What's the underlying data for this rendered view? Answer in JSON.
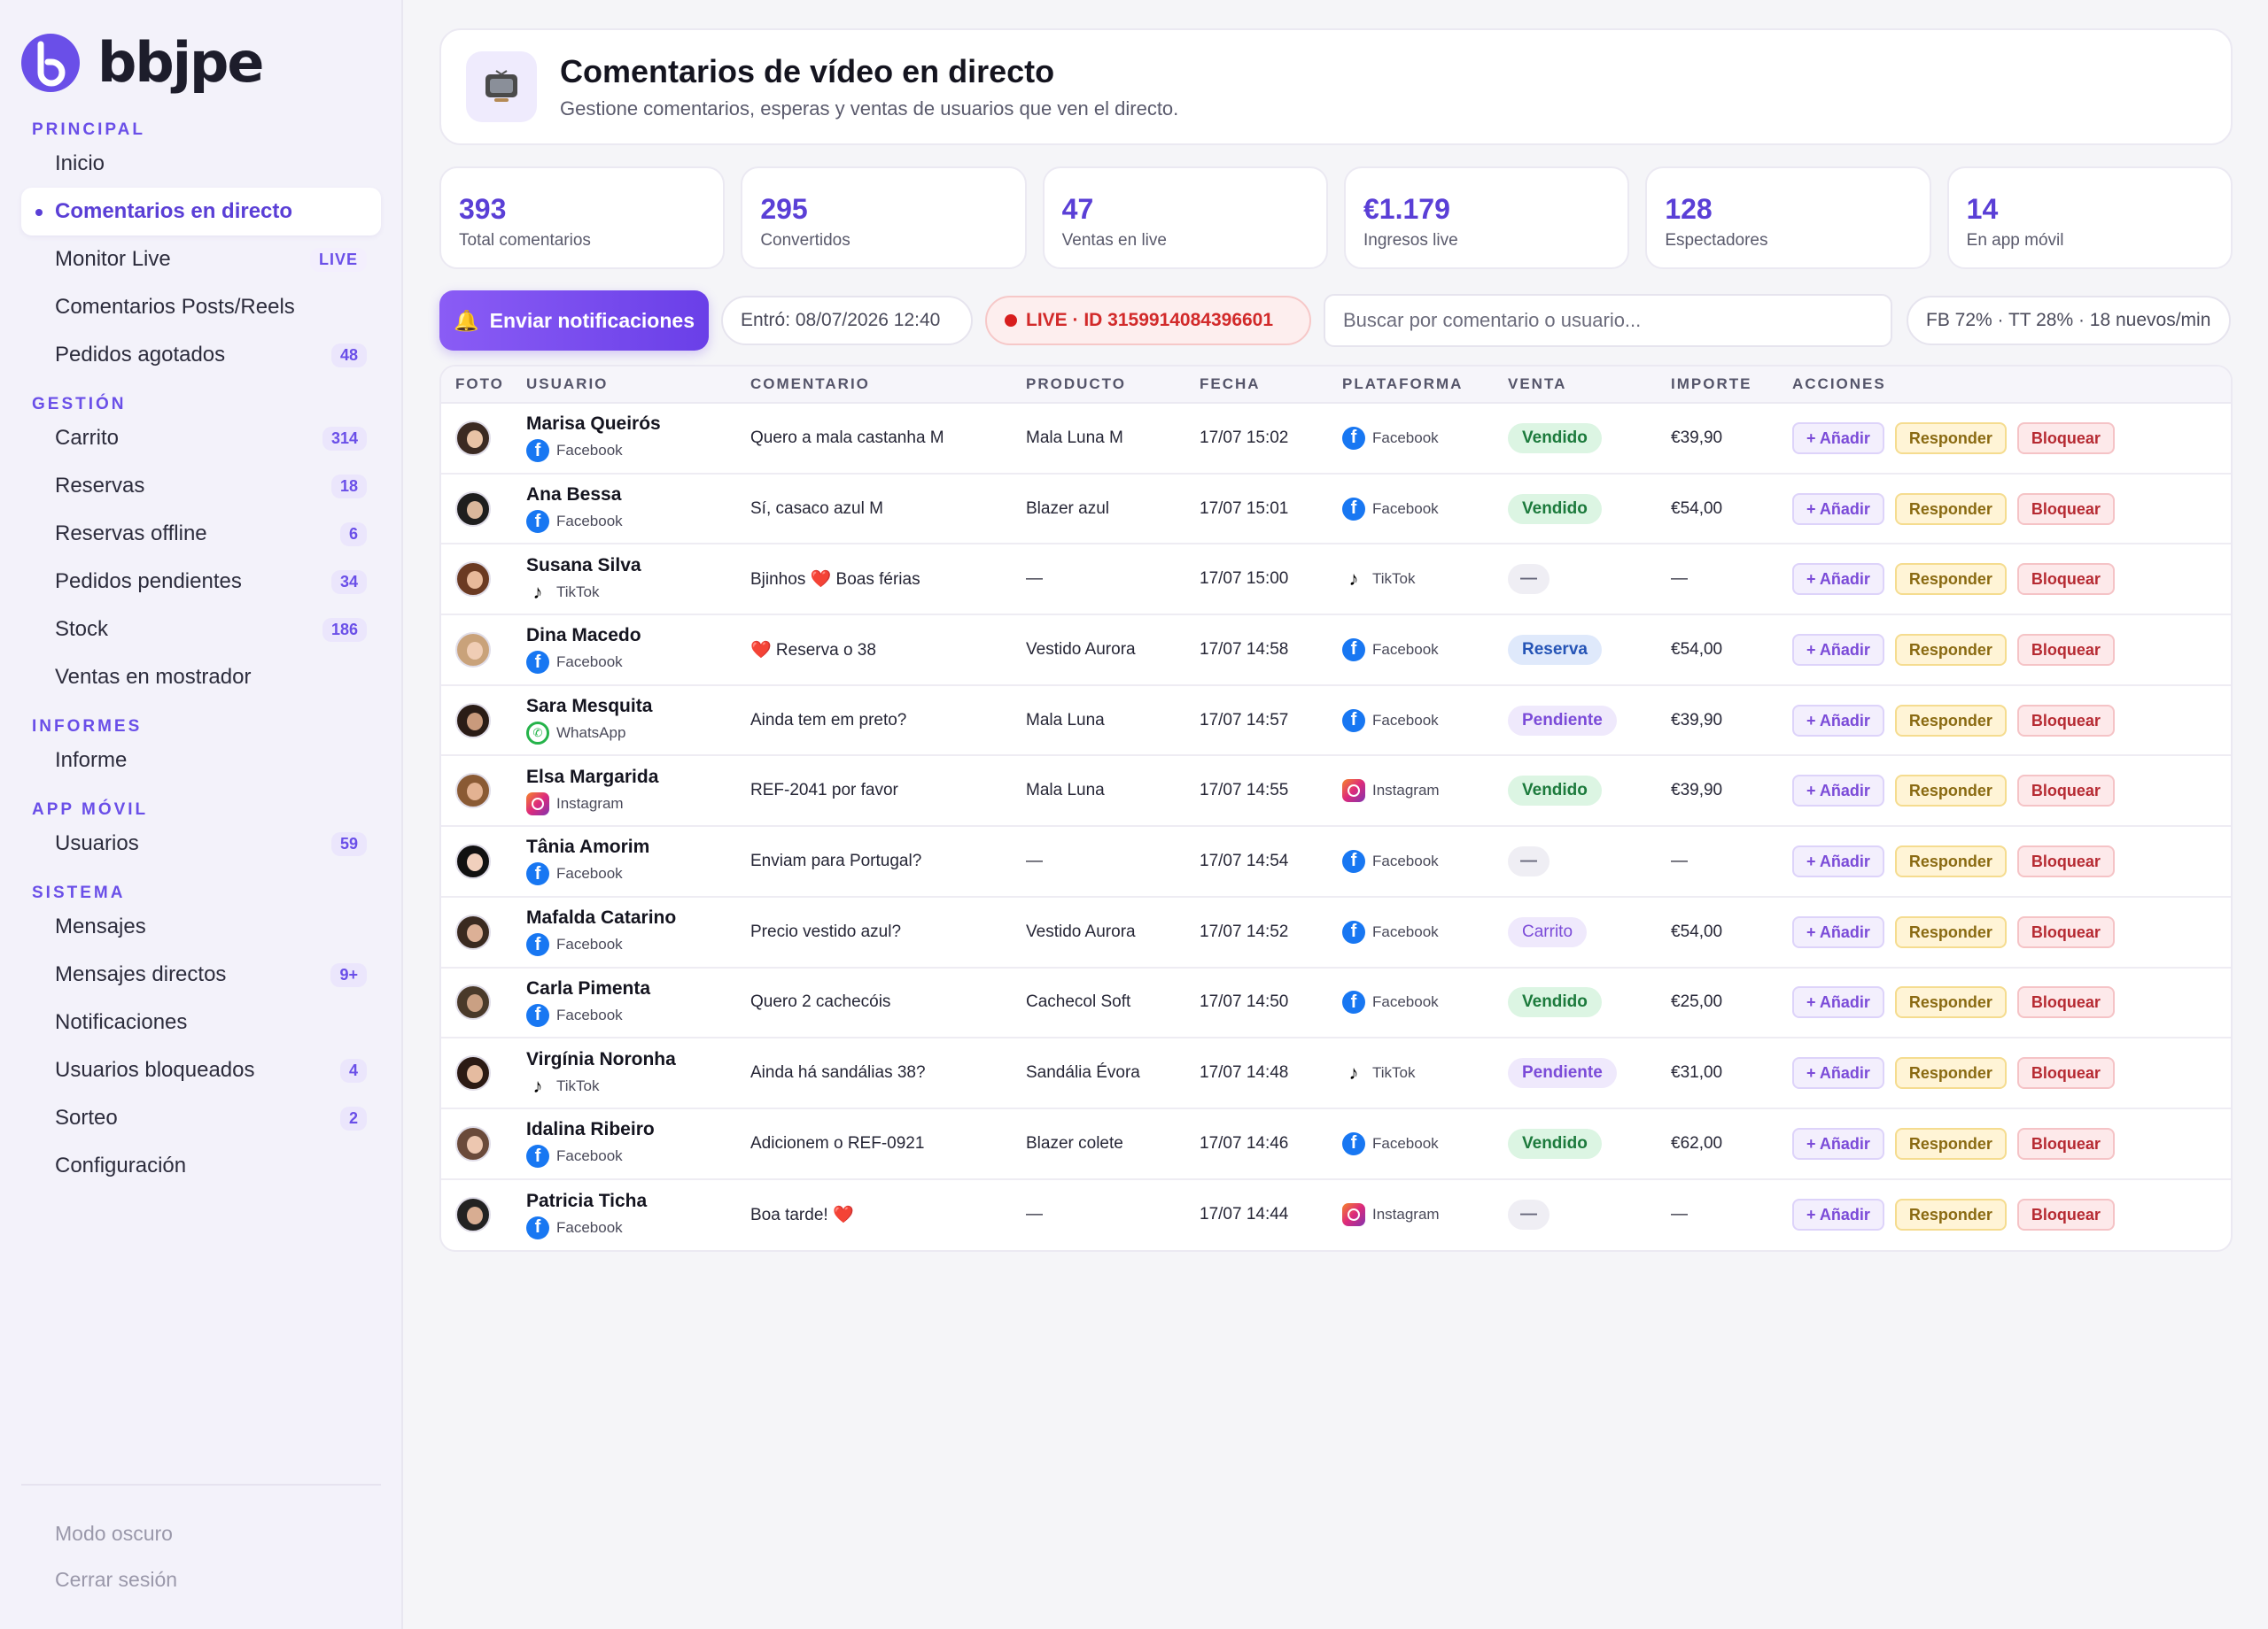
{
  "brand": {
    "name": "bbjpe"
  },
  "sidebar": {
    "sections": [
      {
        "title": "PRINCIPAL",
        "items": [
          {
            "label": "Inicio",
            "badge": ""
          },
          {
            "label": "Comentarios en directo",
            "badge": "",
            "active": true
          },
          {
            "label": "Monitor Live",
            "badge": "LIVE"
          },
          {
            "label": "Comentarios Posts/Reels",
            "badge": ""
          },
          {
            "label": "Pedidos agotados",
            "badge": "48"
          }
        ]
      },
      {
        "title": "GESTIÓN",
        "items": [
          {
            "label": "Carrito",
            "badge": "314"
          },
          {
            "label": "Reservas",
            "badge": "18"
          },
          {
            "label": "Reservas offline",
            "badge": "6"
          },
          {
            "label": "Pedidos pendientes",
            "badge": "34"
          },
          {
            "label": "Stock",
            "badge": "186"
          },
          {
            "label": "Ventas en mostrador",
            "badge": ""
          }
        ]
      },
      {
        "title": "INFORMES",
        "items": [
          {
            "label": "Informe",
            "badge": ""
          }
        ]
      },
      {
        "title": "APP MÓVIL",
        "items": [
          {
            "label": "Usuarios",
            "badge": "59"
          }
        ]
      },
      {
        "title": "SISTEMA",
        "items": [
          {
            "label": "Mensajes",
            "badge": ""
          },
          {
            "label": "Mensajes directos",
            "badge": "9+"
          },
          {
            "label": "Notificaciones",
            "badge": ""
          },
          {
            "label": "Usuarios bloqueados",
            "badge": "4"
          },
          {
            "label": "Sorteo",
            "badge": "2"
          },
          {
            "label": "Configuración",
            "badge": ""
          }
        ]
      }
    ],
    "footer": {
      "dark_mode": "Modo oscuro",
      "logout": "Cerrar sesión"
    }
  },
  "header": {
    "icon": "tv-icon",
    "title": "Comentarios de vídeo en directo",
    "subtitle": "Gestione comentarios, esperas y ventas de usuarios que ven el directo."
  },
  "stats": [
    {
      "value": "393",
      "label": "Total comentarios"
    },
    {
      "value": "295",
      "label": "Convertidos"
    },
    {
      "value": "47",
      "label": "Ventas en live"
    },
    {
      "value": "€1.179",
      "label": "Ingresos live"
    },
    {
      "value": "128",
      "label": "Espectadores"
    },
    {
      "value": "14",
      "label": "En app móvil"
    }
  ],
  "toolbar": {
    "notify_label": "Enviar notificaciones",
    "entered": "Entró: 08/07/2026 12:40",
    "live_label": "LIVE · ID 315991408439660​1",
    "search_placeholder": "Buscar por comentario o usuario...",
    "platform_stats": "FB 72% · TT 28% · 18 nuevos/min"
  },
  "table": {
    "headers": {
      "foto": "FOTO",
      "usuario": "USUARIO",
      "comentario": "COMENTARIO",
      "producto": "PRODUCTO",
      "fecha": "FECHA",
      "plataforma": "PLATAFORMA",
      "venta": "VENTA",
      "importe": "IMPORTE",
      "acciones": "ACCIONES"
    },
    "actions": {
      "add": "+ Añadir",
      "reply": "Responder",
      "block": "Bloquear"
    },
    "rows": [
      {
        "name": "Marisa Queirós",
        "platform": "Facebook",
        "comment": "Quero a mala castanha M",
        "product": "Mala Luna M",
        "date": "17/07 15:02",
        "sale": "Vendido",
        "amount": "€39,90"
      },
      {
        "name": "Ana Bessa",
        "platform": "Facebook",
        "comment": "Sí, casaco azul M",
        "product": "Blazer azul",
        "date": "17/07 15:01",
        "sale": "Vendido",
        "amount": "€54,00"
      },
      {
        "name": "Susana Silva",
        "platform": "TikTok",
        "comment": "Bjinhos ❤️ Boas férias",
        "product": "—",
        "date": "17/07 15:00",
        "sale": "—",
        "amount": "—"
      },
      {
        "name": "Dina Macedo",
        "platform": "Facebook",
        "comment": "❤️ Reserva o 38",
        "product": "Vestido Aurora",
        "date": "17/07 14:58",
        "sale": "Reserva",
        "amount": "€54,00"
      },
      {
        "name": "Sara Mesquita",
        "platform": "WhatsApp",
        "platform_col": "Facebook",
        "comment": "Ainda tem em preto?",
        "product": "Mala Luna",
        "date": "17/07 14:57",
        "sale": "Pendiente",
        "amount": "€39,90"
      },
      {
        "name": "Elsa Margarida",
        "platform": "Instagram",
        "comment": "REF-2041 por favor",
        "product": "Mala Luna",
        "date": "17/07 14:55",
        "sale": "Vendido",
        "amount": "€39,90"
      },
      {
        "name": "Tânia Amorim",
        "platform": "Facebook",
        "comment": "Enviam para Portugal?",
        "product": "—",
        "date": "17/07 14:54",
        "sale": "—",
        "amount": "—"
      },
      {
        "name": "Mafalda Catarino",
        "platform": "Facebook",
        "comment": "Precio vestido azul?",
        "product": "Vestido Aurora",
        "date": "17/07 14:52",
        "sale": "Carrito",
        "amount": "€54,00"
      },
      {
        "name": "Carla Pimenta",
        "platform": "Facebook",
        "comment": "Quero 2 cachecóis",
        "product": "Cachecol Soft",
        "date": "17/07 14:50",
        "sale": "Vendido",
        "amount": "€25,00"
      },
      {
        "name": "Virgínia Noronha",
        "platform": "TikTok",
        "comment": "Ainda há sandálias 38?",
        "product": "Sandália Évora",
        "date": "17/07 14:48",
        "sale": "Pendiente",
        "amount": "€31,00"
      },
      {
        "name": "Idalina Ribeiro",
        "platform": "Facebook",
        "comment": "Adicionem o REF-0921",
        "product": "Blazer colete",
        "date": "17/07 14:46",
        "sale": "Vendido",
        "amount": "€62,00"
      },
      {
        "name": "Patricia Ticha",
        "platform": "Facebook",
        "platform_col": "Instagram",
        "comment": "Boa tarde! ❤️",
        "product": "—",
        "date": "17/07 14:44",
        "sale": "—",
        "amount": "—"
      }
    ]
  }
}
